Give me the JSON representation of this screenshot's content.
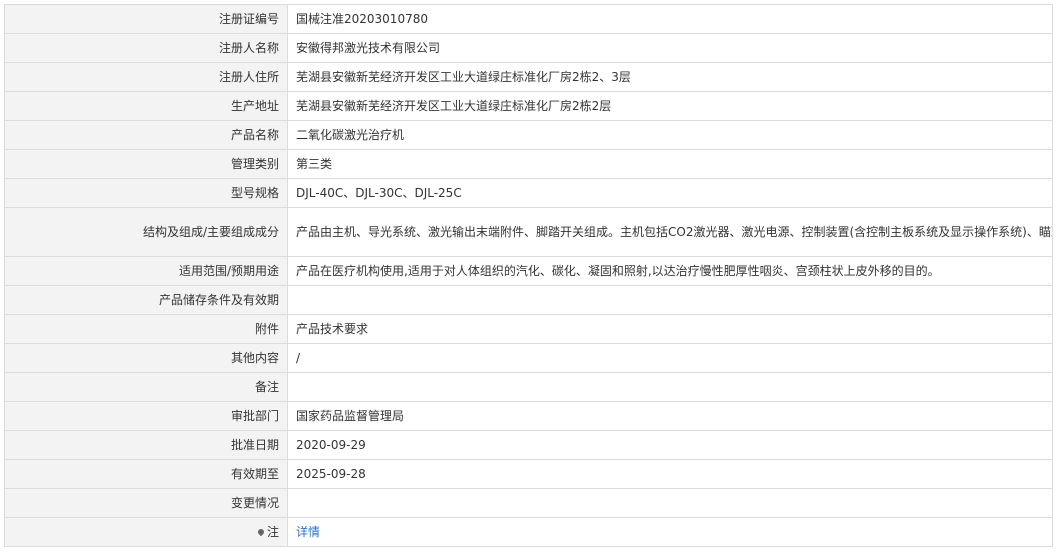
{
  "rows": [
    {
      "label": "注册证编号",
      "value": "国械注准20203010780"
    },
    {
      "label": "注册人名称",
      "value": "安徽得邦激光技术有限公司"
    },
    {
      "label": "注册人住所",
      "value": "芜湖县安徽新芜经济开发区工业大道绿庄标准化厂房2栋2、3层"
    },
    {
      "label": "生产地址",
      "value": "芜湖县安徽新芜经济开发区工业大道绿庄标准化厂房2栋2层"
    },
    {
      "label": "产品名称",
      "value": "二氧化碳激光治疗机"
    },
    {
      "label": "管理类别",
      "value": "第三类"
    },
    {
      "label": "型号规格",
      "value": "DJL-40C、DJL-30C、DJL-25C"
    },
    {
      "label": "结构及组成/主要组成成分",
      "value": "产品由主机、导光系统、激光输出末端附件、脚踏开关组成。主机包括CO2激光器、激光电源、控制装置(含控制主板系统及显示操作系统)、瞄准装置、安全防护系统、冷却系统。导光系统为关节臂,激光输出末端附件包括聚焦头(100mm和50mm)、延长头和T型头。"
    },
    {
      "label": "适用范围/预期用途",
      "value": "产品在医疗机构使用,适用于对人体组织的汽化、碳化、凝固和照射,以达治疗慢性肥厚性咽炎、宫颈柱状上皮外移的目的。"
    },
    {
      "label": "产品储存条件及有效期",
      "value": ""
    },
    {
      "label": "附件",
      "value": "产品技术要求"
    },
    {
      "label": "其他内容",
      "value": "/"
    },
    {
      "label": "备注",
      "value": ""
    },
    {
      "label": "审批部门",
      "value": "国家药品监督管理局"
    },
    {
      "label": "批准日期",
      "value": "2020-09-29"
    },
    {
      "label": "有效期至",
      "value": "2025-09-28"
    },
    {
      "label": "变更情况",
      "value": ""
    }
  ],
  "note": {
    "label": "注",
    "link_text": "详情",
    "icon": "pin-icon"
  }
}
